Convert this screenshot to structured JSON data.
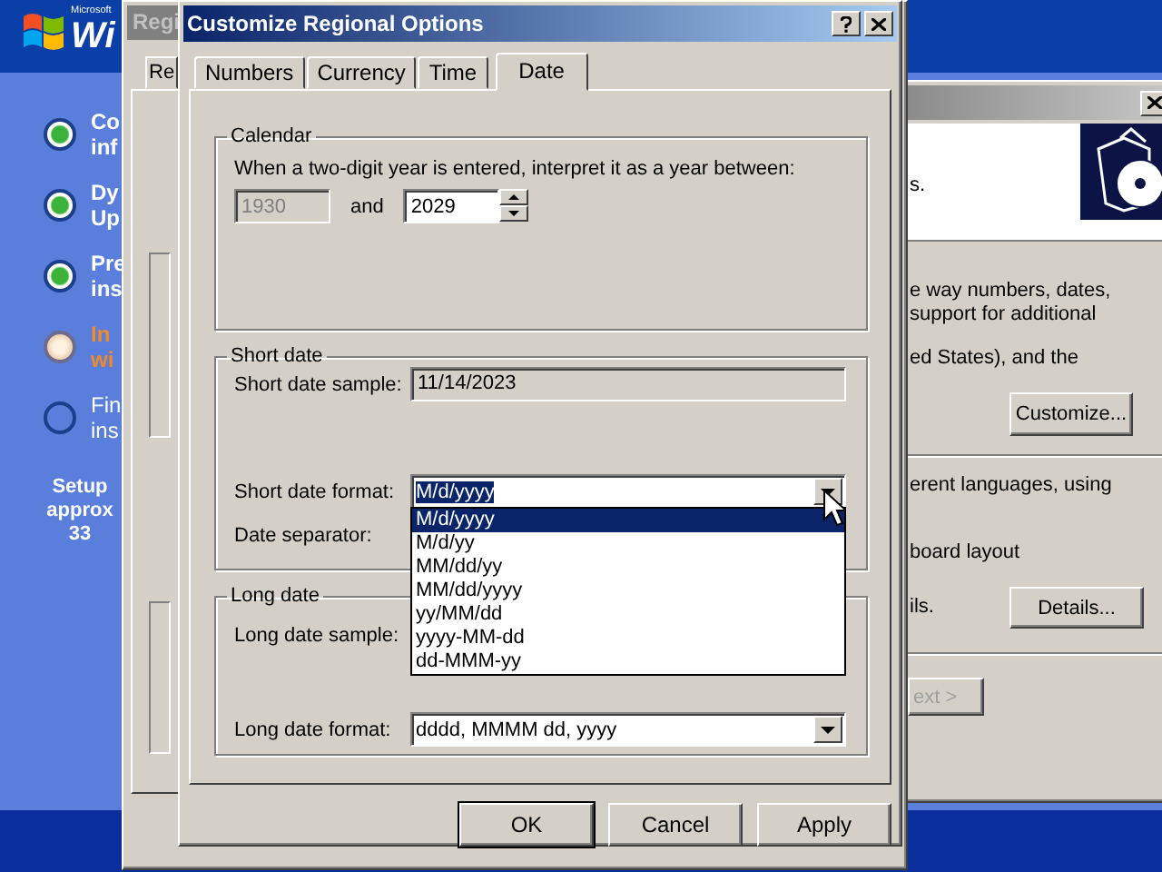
{
  "setup_screen": {
    "logo": {
      "small": "Microsoft",
      "large": "Wi"
    },
    "steps": [
      {
        "lines": [
          "Co",
          "inf"
        ],
        "done": true,
        "current": false
      },
      {
        "lines": [
          "Dy",
          "Up"
        ],
        "done": true,
        "current": false
      },
      {
        "lines": [
          "Pre",
          "ins"
        ],
        "done": true,
        "current": false
      },
      {
        "lines": [
          "In",
          "wi"
        ],
        "done": false,
        "current": true
      },
      {
        "lines": [
          "Fin",
          "ins"
        ],
        "done": false,
        "current": false
      }
    ],
    "estimate_lines": [
      "Setup",
      "approx",
      "33"
    ]
  },
  "wizard_window": {
    "header_text": "s.",
    "section_1": {
      "lines": [
        "e way numbers, dates,",
        "support for additional",
        "ed States), and the"
      ],
      "button": "Customize..."
    },
    "section_2": {
      "lines": [
        "erent languages, using",
        "board layout",
        "ils."
      ],
      "button": "Details..."
    },
    "next_button": "ext >"
  },
  "regional_window": {
    "title": "Regi",
    "tab": "Re"
  },
  "dialog": {
    "title": "Customize Regional Options",
    "tabs": [
      {
        "label": "Numbers",
        "selected": false
      },
      {
        "label": "Currency",
        "selected": false
      },
      {
        "label": "Time",
        "selected": false
      },
      {
        "label": "Date",
        "selected": true
      }
    ],
    "calendar": {
      "legend": "Calendar",
      "prompt": "When a two-digit year is entered, interpret it as a year between:",
      "from_year": {
        "value": "1930",
        "disabled": true
      },
      "and_label": "and",
      "to_year": {
        "value": "2029",
        "disabled": false
      }
    },
    "short_date": {
      "legend": "Short date",
      "sample_label": "Short date sample:",
      "sample": "11/14/2023",
      "format_label": "Short date format:",
      "format": {
        "value": "M/d/yyyy",
        "highlighted": true
      },
      "separator_label": "Date separator:",
      "format_options": [
        {
          "label": "M/d/yyyy",
          "selected": true
        },
        {
          "label": "M/d/yy",
          "selected": false
        },
        {
          "label": "MM/dd/yy",
          "selected": false
        },
        {
          "label": "MM/dd/yyyy",
          "selected": false
        },
        {
          "label": "yy/MM/dd",
          "selected": false
        },
        {
          "label": "yyyy-MM-dd",
          "selected": false
        },
        {
          "label": "dd-MMM-yy",
          "selected": false
        }
      ]
    },
    "long_date": {
      "legend": "Long date",
      "sample_label": "Long date sample:",
      "format_label": "Long date format:",
      "format": {
        "value": "dddd, MMMM dd, yyyy",
        "highlighted": false
      }
    },
    "buttons": [
      {
        "label": "OK",
        "default": true
      },
      {
        "label": "Cancel",
        "default": false
      },
      {
        "label": "Apply",
        "default": false
      }
    ]
  }
}
